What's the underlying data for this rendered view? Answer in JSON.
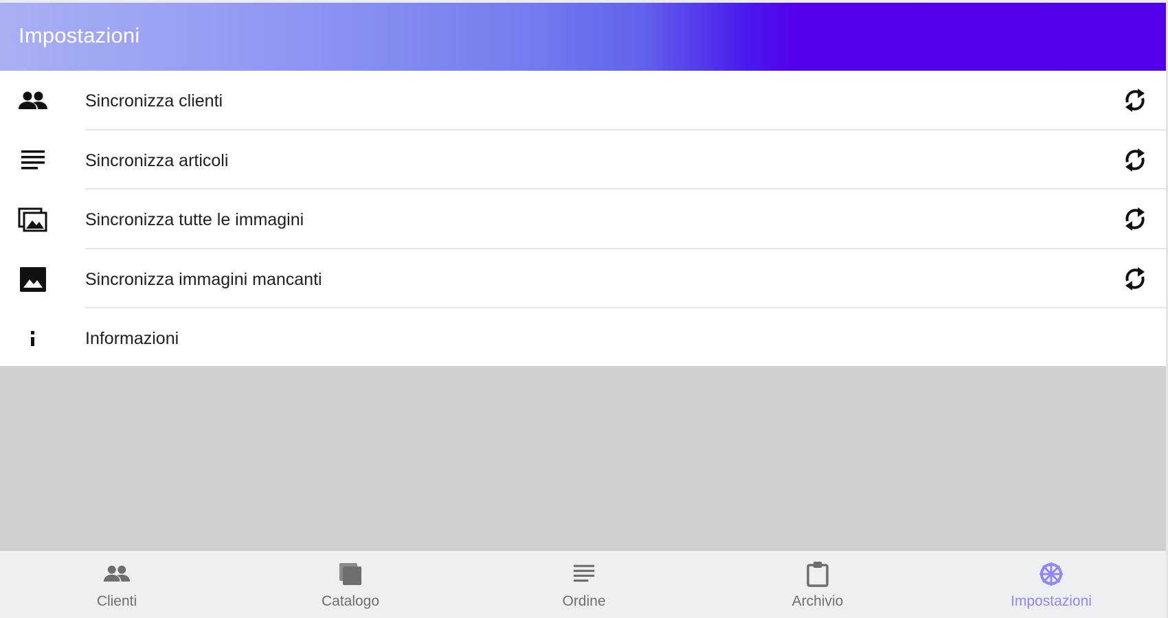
{
  "header": {
    "title": "Impostazioni"
  },
  "settings": {
    "items": [
      {
        "label": "Sincronizza clienti",
        "icon": "people-icon",
        "has_sync": true
      },
      {
        "label": "Sincronizza articoli",
        "icon": "list-lines-icon",
        "has_sync": true
      },
      {
        "label": "Sincronizza tutte le immagini",
        "icon": "image-collection-icon",
        "has_sync": true
      },
      {
        "label": "Sincronizza immagini mancanti",
        "icon": "image-icon",
        "has_sync": true
      },
      {
        "label": "Informazioni",
        "icon": "info-icon",
        "has_sync": false
      }
    ],
    "sync_icon": "sync-icon"
  },
  "bottom_nav": {
    "items": [
      {
        "label": "Clienti",
        "icon": "people-icon",
        "active": false
      },
      {
        "label": "Catalogo",
        "icon": "catalog-icon",
        "active": false
      },
      {
        "label": "Ordine",
        "icon": "list-lines-icon",
        "active": false
      },
      {
        "label": "Archivio",
        "icon": "clipboard-icon",
        "active": false
      },
      {
        "label": "Impostazioni",
        "icon": "settings-wheel-icon",
        "active": true
      }
    ]
  },
  "colors": {
    "header_gradient_start": "#a9b0f4",
    "header_gradient_end": "#5300ea",
    "active_tab": "#8f88f4",
    "inactive_tab": "#6e6e6e",
    "empty_area": "#d0d0d0"
  }
}
